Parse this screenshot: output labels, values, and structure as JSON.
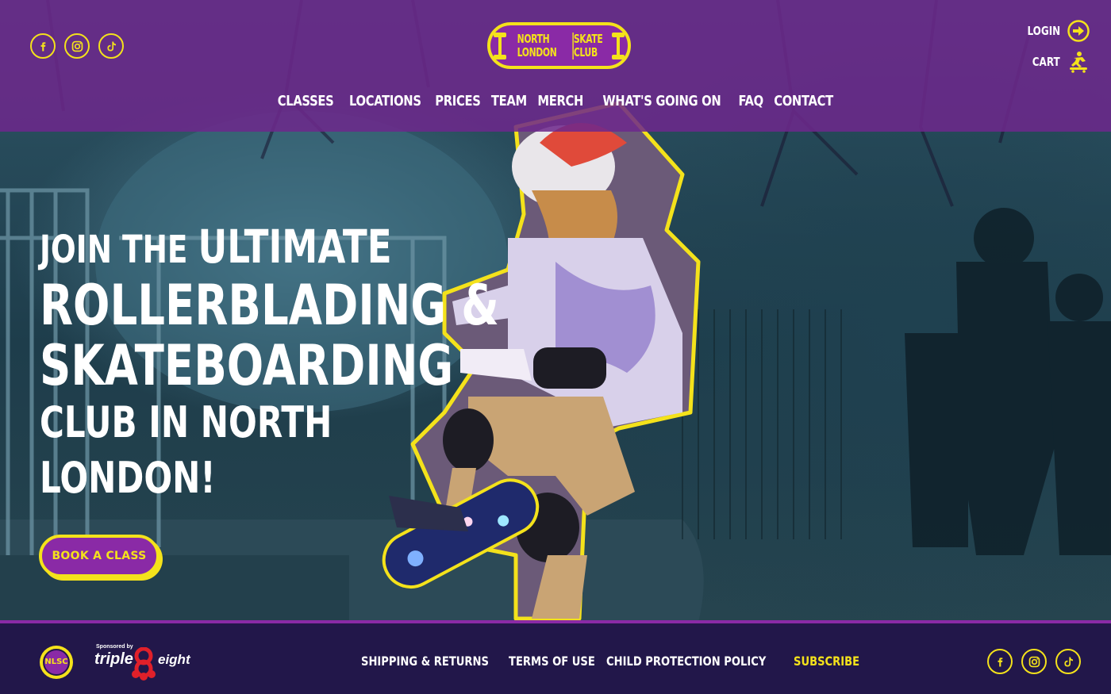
{
  "colors": {
    "accent": "#f4e21b",
    "purple": "#8a2aa6",
    "footer": "#22174a"
  },
  "header": {
    "social": [
      {
        "name": "facebook-icon",
        "glyph": "f"
      },
      {
        "name": "instagram-icon",
        "glyph": ""
      },
      {
        "name": "tiktok-icon",
        "glyph": ""
      }
    ],
    "logo": {
      "north": "NORTH",
      "skate": "SKATE",
      "london": "LONDON",
      "club": "CLUB"
    },
    "login_label": "LOGIN",
    "cart_label": "CART",
    "nav": [
      {
        "label": "CLASSES"
      },
      {
        "label": "LOCATIONS"
      },
      {
        "label": "PRICES"
      },
      {
        "label": "TEAM"
      },
      {
        "label": "MERCH"
      },
      {
        "label": "WHAT'S GOING ON"
      },
      {
        "label": "FAQ"
      },
      {
        "label": "CONTACT"
      }
    ]
  },
  "hero": {
    "headline_join": "JOIN THE ",
    "headline_ultimate": "ULTIMATE",
    "headline_line2": "ROLLERBLADING &",
    "headline_line3": "SKATEBOARDING",
    "headline_line4": "CLUB IN NORTH",
    "headline_line5": "LONDON!",
    "cta_label": "BOOK A CLASS"
  },
  "footer": {
    "badge_text_top": "NL",
    "badge_text_bottom": "SC",
    "sponsor_by": "Sponsored by",
    "sponsor_brand_1": "triple",
    "sponsor_brand_2": "eight",
    "links": [
      {
        "label": "SHIPPING & RETURNS"
      },
      {
        "label": "TERMS OF USE"
      },
      {
        "label": "CHILD PROTECTION POLICY"
      },
      {
        "label": "SUBSCRIBE"
      }
    ]
  }
}
